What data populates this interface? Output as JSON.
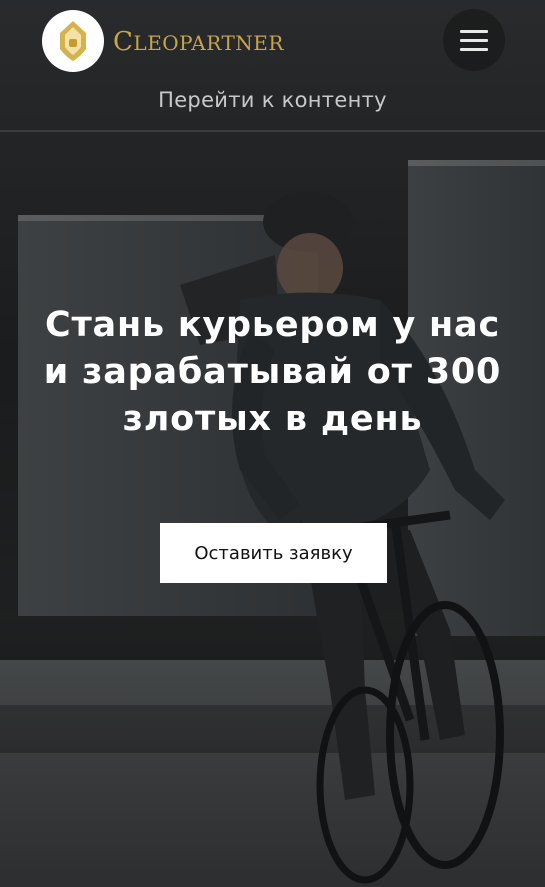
{
  "header": {
    "brand_name": "Cleopartner",
    "logo_icon": "pharaoh-logo-icon",
    "menu_icon": "hamburger-icon"
  },
  "skip_link": "Перейти к контенту",
  "hero": {
    "headline": "Стань курьером у нас и зарабатывай от 300 злотых в день",
    "cta_label": "Оставить заявку",
    "background": "cyclist-courier-photo"
  },
  "colors": {
    "brand_gold": "#c9a54a",
    "cta_background": "#ffffff",
    "headline": "#ffffff"
  }
}
